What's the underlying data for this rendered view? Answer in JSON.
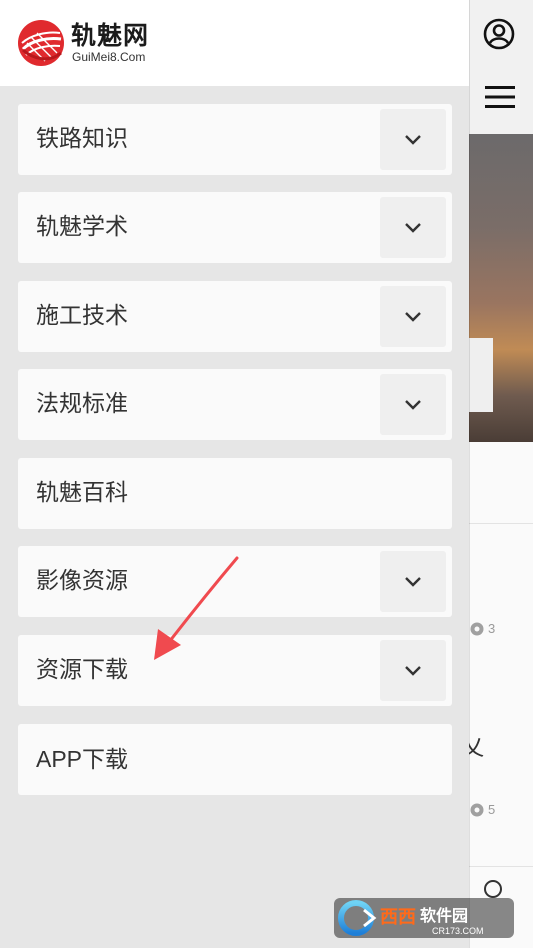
{
  "drawer": {
    "logo": {
      "name": "轨魅网",
      "domain": "GuiMei8.Com"
    },
    "items": [
      {
        "label": "铁路知识",
        "has_toggle": true
      },
      {
        "label": "轨魅学术",
        "has_toggle": true
      },
      {
        "label": "施工技术",
        "has_toggle": true
      },
      {
        "label": "法规标准",
        "has_toggle": true
      },
      {
        "label": "轨魅百科",
        "has_toggle": false
      },
      {
        "label": "影像资源",
        "has_toggle": true
      },
      {
        "label": "资源下载",
        "has_toggle": true
      },
      {
        "label": "APP下载",
        "has_toggle": false
      }
    ]
  },
  "background": {
    "icons": [
      "user-icon",
      "hamburger-menu-icon",
      "eye-icon"
    ],
    "view_counts": [
      "3",
      "5"
    ],
    "partial_char": "乂"
  },
  "annotation": {
    "color": "#f04a4f"
  },
  "watermark": {
    "brand": "西西软件园",
    "site": "CR173.COM"
  }
}
